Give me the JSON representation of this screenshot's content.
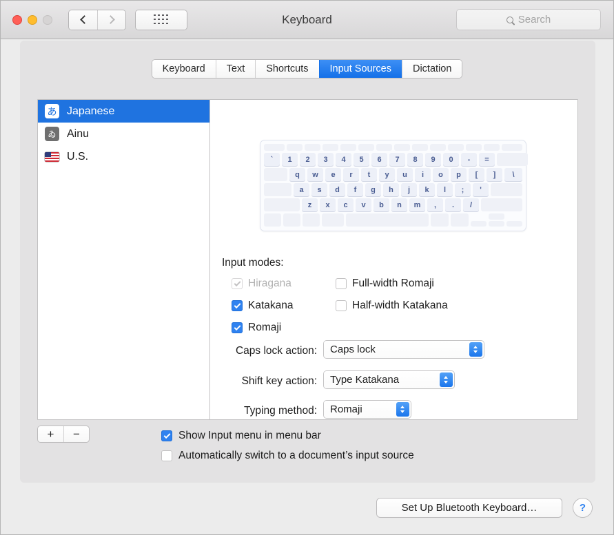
{
  "window": {
    "title": "Keyboard",
    "traffic_lights": [
      "close",
      "minimize",
      "zoom-disabled"
    ],
    "nav": {
      "back": "back-icon",
      "forward": "forward-icon"
    },
    "grid_button": "show-all-icon",
    "search": {
      "placeholder": "Search",
      "value": "",
      "icon": "search-icon"
    }
  },
  "tabs": [
    {
      "label": "Keyboard",
      "active": false
    },
    {
      "label": "Text",
      "active": false
    },
    {
      "label": "Shortcuts",
      "active": false
    },
    {
      "label": "Input Sources",
      "active": true
    },
    {
      "label": "Dictation",
      "active": false
    }
  ],
  "input_sources": [
    {
      "label": "Japanese",
      "icon": "あ",
      "selected": true
    },
    {
      "label": "Ainu",
      "icon": "ゐ",
      "selected": false
    },
    {
      "label": "U.S.",
      "icon": "us-flag-icon",
      "selected": false
    }
  ],
  "keyboard_preview": {
    "rows": [
      [
        "",
        "",
        "",
        "",
        "",
        "",
        "",
        "",
        "",
        "",
        "",
        "",
        "",
        ""
      ],
      [
        "`",
        "1",
        "2",
        "3",
        "4",
        "5",
        "6",
        "7",
        "8",
        "9",
        "0",
        "-",
        "=",
        ""
      ],
      [
        "",
        "q",
        "w",
        "e",
        "r",
        "t",
        "y",
        "u",
        "i",
        "o",
        "p",
        "[",
        "]",
        "\\"
      ],
      [
        "",
        "a",
        "s",
        "d",
        "f",
        "g",
        "h",
        "j",
        "k",
        "l",
        ";",
        "'",
        ""
      ],
      [
        "",
        "z",
        "x",
        "c",
        "v",
        "b",
        "n",
        "m",
        ",",
        ".",
        "/",
        ""
      ],
      [
        "",
        "",
        "",
        "",
        "",
        "",
        "",
        "",
        ""
      ]
    ]
  },
  "detail": {
    "input_modes_label": "Input modes:",
    "input_modes": [
      {
        "label": "Hiragana",
        "checked": true,
        "enabled": false,
        "column": "left"
      },
      {
        "label": "Katakana",
        "checked": true,
        "enabled": true,
        "column": "left"
      },
      {
        "label": "Romaji",
        "checked": true,
        "enabled": true,
        "column": "left"
      },
      {
        "label": "Full-width Romaji",
        "checked": false,
        "enabled": true,
        "column": "right"
      },
      {
        "label": "Half-width Katakana",
        "checked": false,
        "enabled": true,
        "column": "right"
      }
    ],
    "popups": [
      {
        "label": "Caps lock action:",
        "value": "Caps lock"
      },
      {
        "label": "Shift key action:",
        "value": "Type Katakana"
      },
      {
        "label": "Typing method:",
        "value": "Romaji"
      }
    ]
  },
  "bottom": {
    "add_label": "+",
    "remove_label": "−",
    "checkboxes": [
      {
        "label": "Show Input menu in menu bar",
        "checked": true
      },
      {
        "label": "Automatically switch to a document’s input source",
        "checked": false
      }
    ]
  },
  "footer": {
    "bluetooth_button": "Set Up Bluetooth Keyboard…",
    "help_button": "?"
  },
  "colors": {
    "accent": "#1f73e0",
    "tab_active": "#2a80ef",
    "checkbox_on": "#2f82f0",
    "window_bg": "#ececec",
    "pane_bg": "#e3e2e3"
  }
}
